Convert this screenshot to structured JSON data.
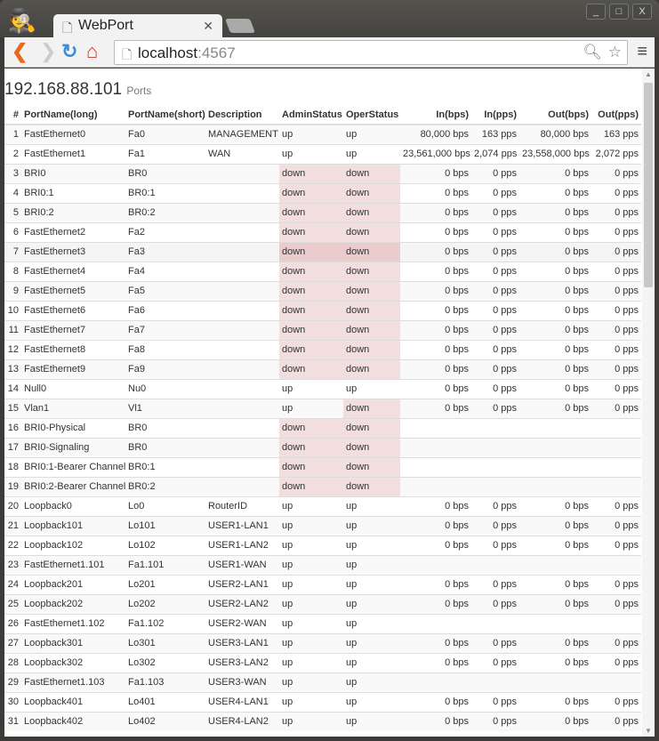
{
  "browser": {
    "tab_title": "WebPort",
    "url_host": "localhost",
    "url_port": ":4567",
    "window_buttons": [
      "_",
      "□",
      "X"
    ]
  },
  "page": {
    "title": "192.168.88.101",
    "subtitle": "Ports"
  },
  "table": {
    "headers": [
      "#",
      "PortName(long)",
      "PortName(short)",
      "Description",
      "AdminStatus",
      "OperStatus",
      "In(bps)",
      "In(pps)",
      "Out(bps)",
      "Out(pps)"
    ],
    "rows": [
      [
        "1",
        "FastEthernet0",
        "Fa0",
        "MANAGEMENT",
        "up",
        "up",
        "80,000 bps",
        "163 pps",
        "80,000 bps",
        "163 pps"
      ],
      [
        "2",
        "FastEthernet1",
        "Fa1",
        "WAN",
        "up",
        "up",
        "23,561,000 bps",
        "2,074 pps",
        "23,558,000 bps",
        "2,072 pps"
      ],
      [
        "3",
        "BRI0",
        "BR0",
        "",
        "down",
        "down",
        "0 bps",
        "0 pps",
        "0 bps",
        "0 pps"
      ],
      [
        "4",
        "BRI0:1",
        "BR0:1",
        "",
        "down",
        "down",
        "0 bps",
        "0 pps",
        "0 bps",
        "0 pps"
      ],
      [
        "5",
        "BRI0:2",
        "BR0:2",
        "",
        "down",
        "down",
        "0 bps",
        "0 pps",
        "0 bps",
        "0 pps"
      ],
      [
        "6",
        "FastEthernet2",
        "Fa2",
        "",
        "down",
        "down",
        "0 bps",
        "0 pps",
        "0 bps",
        "0 pps"
      ],
      [
        "7",
        "FastEthernet3",
        "Fa3",
        "",
        "down",
        "down",
        "0 bps",
        "0 pps",
        "0 bps",
        "0 pps"
      ],
      [
        "8",
        "FastEthernet4",
        "Fa4",
        "",
        "down",
        "down",
        "0 bps",
        "0 pps",
        "0 bps",
        "0 pps"
      ],
      [
        "9",
        "FastEthernet5",
        "Fa5",
        "",
        "down",
        "down",
        "0 bps",
        "0 pps",
        "0 bps",
        "0 pps"
      ],
      [
        "10",
        "FastEthernet6",
        "Fa6",
        "",
        "down",
        "down",
        "0 bps",
        "0 pps",
        "0 bps",
        "0 pps"
      ],
      [
        "11",
        "FastEthernet7",
        "Fa7",
        "",
        "down",
        "down",
        "0 bps",
        "0 pps",
        "0 bps",
        "0 pps"
      ],
      [
        "12",
        "FastEthernet8",
        "Fa8",
        "",
        "down",
        "down",
        "0 bps",
        "0 pps",
        "0 bps",
        "0 pps"
      ],
      [
        "13",
        "FastEthernet9",
        "Fa9",
        "",
        "down",
        "down",
        "0 bps",
        "0 pps",
        "0 bps",
        "0 pps"
      ],
      [
        "14",
        "Null0",
        "Nu0",
        "",
        "up",
        "up",
        "0 bps",
        "0 pps",
        "0 bps",
        "0 pps"
      ],
      [
        "15",
        "Vlan1",
        "Vl1",
        "",
        "up",
        "down",
        "0 bps",
        "0 pps",
        "0 bps",
        "0 pps"
      ],
      [
        "16",
        "BRI0-Physical",
        "BR0",
        "",
        "down",
        "down",
        "",
        "",
        "",
        ""
      ],
      [
        "17",
        "BRI0-Signaling",
        "BR0",
        "",
        "down",
        "down",
        "",
        "",
        "",
        ""
      ],
      [
        "18",
        "BRI0:1-Bearer Channel",
        "BR0:1",
        "",
        "down",
        "down",
        "",
        "",
        "",
        ""
      ],
      [
        "19",
        "BRI0:2-Bearer Channel",
        "BR0:2",
        "",
        "down",
        "down",
        "",
        "",
        "",
        ""
      ],
      [
        "20",
        "Loopback0",
        "Lo0",
        "RouterID",
        "up",
        "up",
        "0 bps",
        "0 pps",
        "0 bps",
        "0 pps"
      ],
      [
        "21",
        "Loopback101",
        "Lo101",
        "USER1-LAN1",
        "up",
        "up",
        "0 bps",
        "0 pps",
        "0 bps",
        "0 pps"
      ],
      [
        "22",
        "Loopback102",
        "Lo102",
        "USER1-LAN2",
        "up",
        "up",
        "0 bps",
        "0 pps",
        "0 bps",
        "0 pps"
      ],
      [
        "23",
        "FastEthernet1.101",
        "Fa1.101",
        "USER1-WAN",
        "up",
        "up",
        "",
        "",
        "",
        ""
      ],
      [
        "24",
        "Loopback201",
        "Lo201",
        "USER2-LAN1",
        "up",
        "up",
        "0 bps",
        "0 pps",
        "0 bps",
        "0 pps"
      ],
      [
        "25",
        "Loopback202",
        "Lo202",
        "USER2-LAN2",
        "up",
        "up",
        "0 bps",
        "0 pps",
        "0 bps",
        "0 pps"
      ],
      [
        "26",
        "FastEthernet1.102",
        "Fa1.102",
        "USER2-WAN",
        "up",
        "up",
        "",
        "",
        "",
        ""
      ],
      [
        "27",
        "Loopback301",
        "Lo301",
        "USER3-LAN1",
        "up",
        "up",
        "0 bps",
        "0 pps",
        "0 bps",
        "0 pps"
      ],
      [
        "28",
        "Loopback302",
        "Lo302",
        "USER3-LAN2",
        "up",
        "up",
        "0 bps",
        "0 pps",
        "0 bps",
        "0 pps"
      ],
      [
        "29",
        "FastEthernet1.103",
        "Fa1.103",
        "USER3-WAN",
        "up",
        "up",
        "",
        "",
        "",
        ""
      ],
      [
        "30",
        "Loopback401",
        "Lo401",
        "USER4-LAN1",
        "up",
        "up",
        "0 bps",
        "0 pps",
        "0 bps",
        "0 pps"
      ],
      [
        "31",
        "Loopback402",
        "Lo402",
        "USER4-LAN2",
        "up",
        "up",
        "0 bps",
        "0 pps",
        "0 bps",
        "0 pps"
      ]
    ],
    "hover_row": 7
  },
  "colors": {
    "down_bg": "#f2dede",
    "down_hover_bg": "#ebcccc"
  }
}
